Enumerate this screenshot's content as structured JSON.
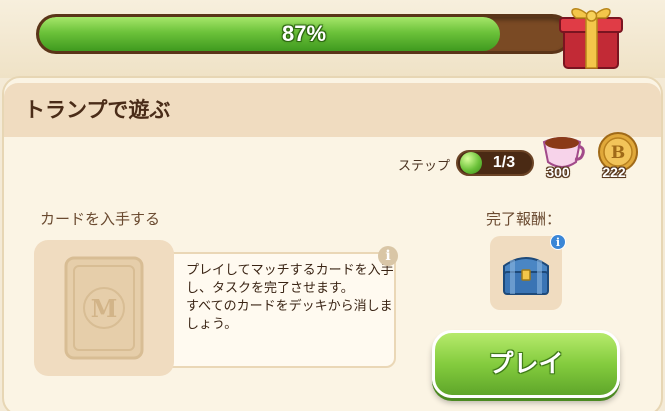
{
  "progress": {
    "percent_label": "87%",
    "fraction": 0.87
  },
  "task": {
    "title": "トランプで遊ぶ",
    "step_label": "ステップ",
    "step_value": "1/3",
    "rewards": [
      {
        "icon": "tea-cup-icon",
        "value": "300"
      },
      {
        "icon": "coin-icon",
        "value": "222"
      }
    ]
  },
  "card_section": {
    "label": "カードを入手する",
    "card_letter": "M",
    "description": "プレイしてマッチするカードを入手し、タスクを完了させます。\nすべてのカードをデッキから消しましょう。",
    "info_glyph": "i"
  },
  "reward_section": {
    "label": "完了報酬：",
    "info_glyph": "i",
    "item_icon": "treasure-chest-icon"
  },
  "play_button": {
    "label": "プレイ"
  },
  "colors": {
    "progress_green": "#6cc23a",
    "button_green": "#84cc3e",
    "panel_bg": "#fbf4e4"
  }
}
